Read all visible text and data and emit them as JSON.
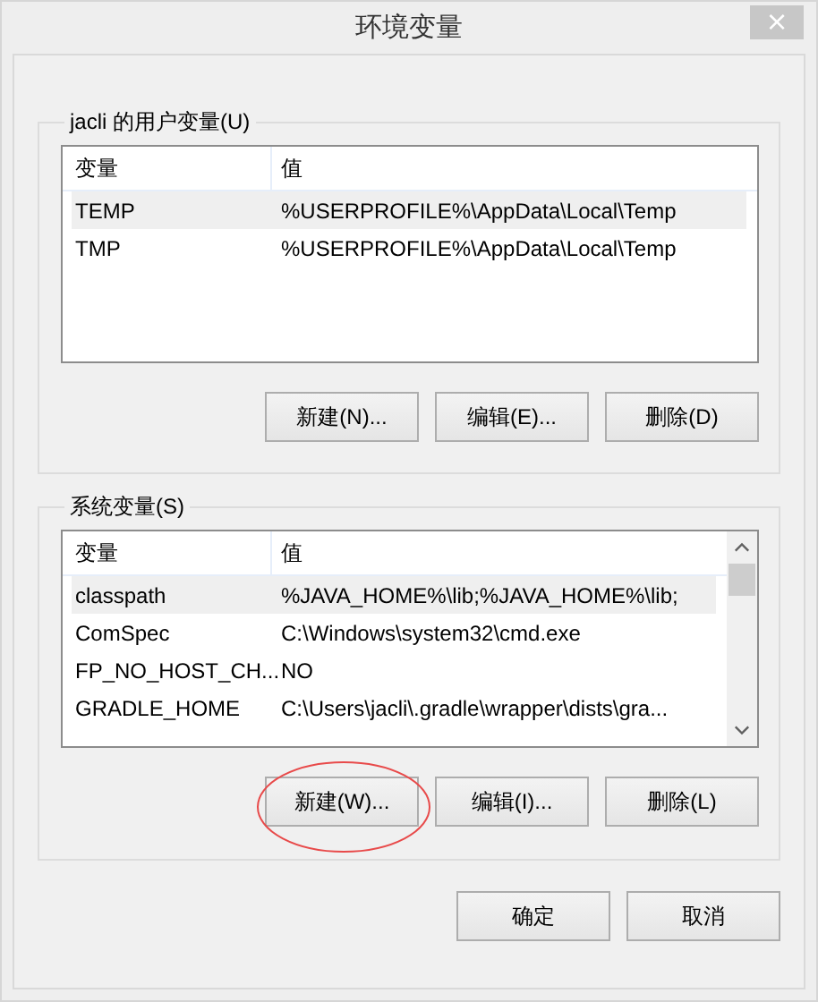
{
  "window": {
    "title": "环境变量",
    "close": "×"
  },
  "user_variables": {
    "label": "jacli 的用户变量(U)",
    "columns": [
      "变量",
      "值"
    ],
    "rows": [
      {
        "name": "TEMP",
        "value": "%USERPROFILE%\\AppData\\Local\\Temp",
        "selected": true
      },
      {
        "name": "TMP",
        "value": "%USERPROFILE%\\AppData\\Local\\Temp",
        "selected": false
      }
    ],
    "buttons": [
      "新建(N)...",
      "编辑(E)...",
      "删除(D)"
    ]
  },
  "system_variables": {
    "label": "系统变量(S)",
    "columns": [
      "变量",
      "值"
    ],
    "rows": [
      {
        "name": "classpath",
        "value": "%JAVA_HOME%\\lib;%JAVA_HOME%\\lib;",
        "selected": true
      },
      {
        "name": "ComSpec",
        "value": "C:\\Windows\\system32\\cmd.exe",
        "selected": false
      },
      {
        "name": "FP_NO_HOST_CH...",
        "value": "NO",
        "selected": false
      },
      {
        "name": "GRADLE_HOME",
        "value": "C:\\Users\\jacli\\.gradle\\wrapper\\dists\\gra...",
        "selected": false
      }
    ],
    "buttons": [
      "新建(W)...",
      "编辑(I)...",
      "删除(L)"
    ],
    "circled_buttons": [
      true,
      false,
      false
    ]
  },
  "buttons": [
    "确定",
    "取消"
  ]
}
